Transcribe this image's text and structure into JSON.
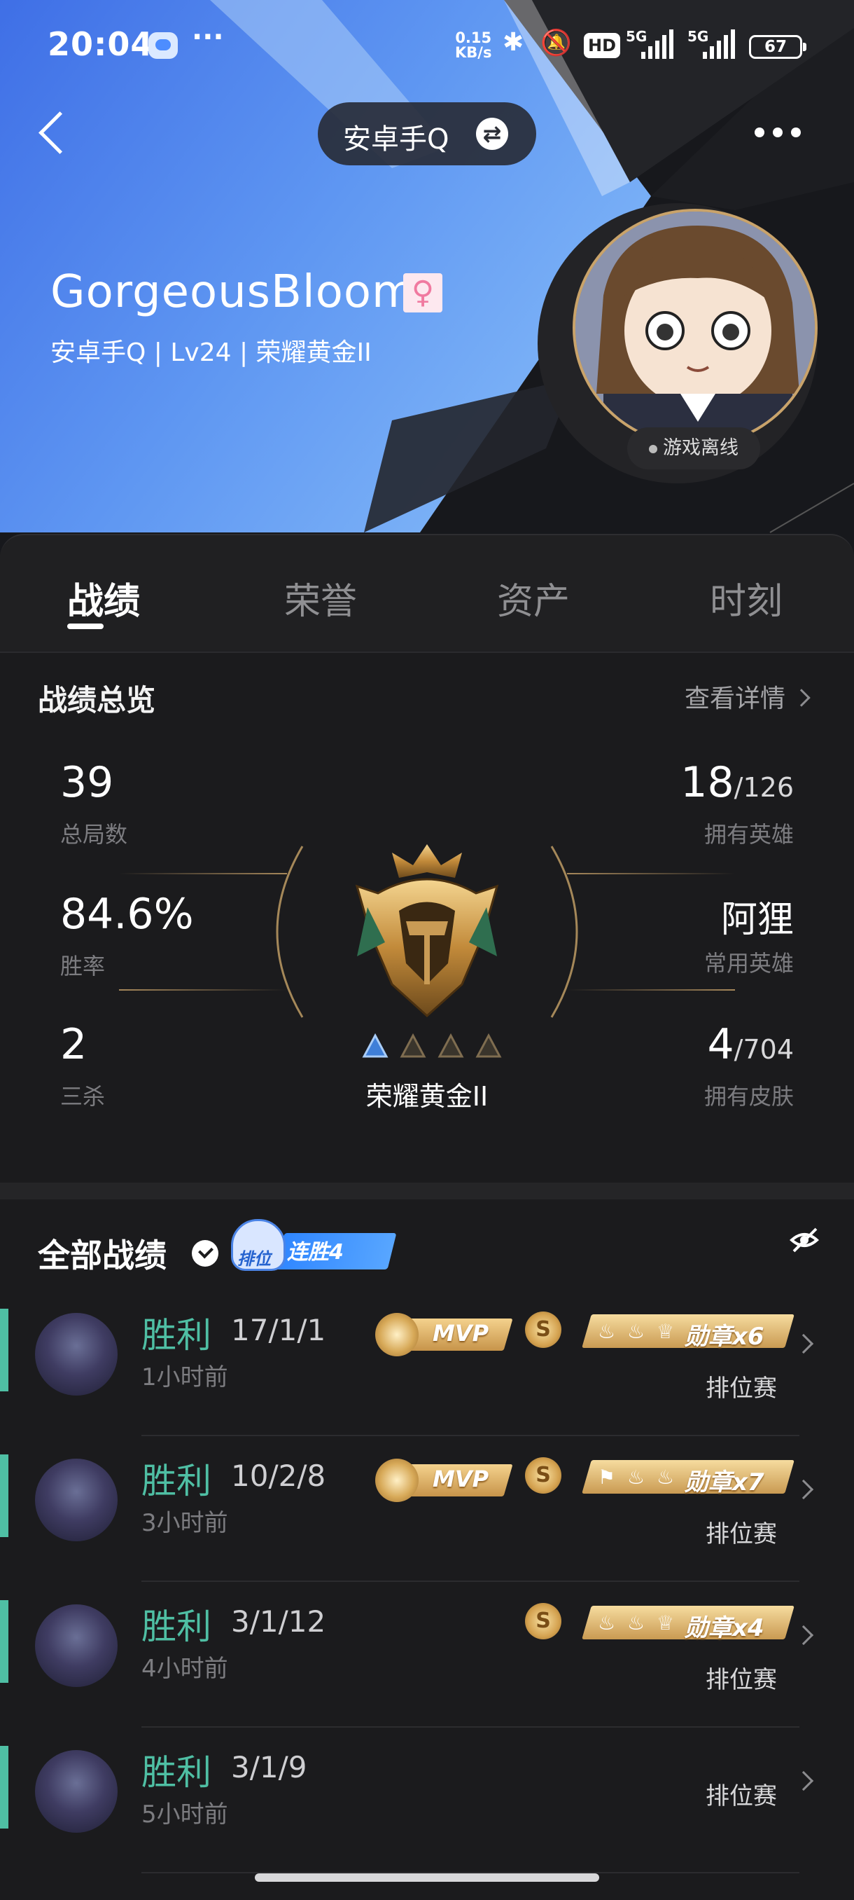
{
  "status_bar": {
    "time": "20:04",
    "net_speed_top": "0.15",
    "net_speed_bottom": "KB/s",
    "hd": "HD",
    "signal1": "5G",
    "signal2": "5G",
    "battery": "67",
    "more": "···"
  },
  "nav": {
    "account": "安卓手Q",
    "switch_icon": "swap-icon"
  },
  "profile": {
    "name": "GorgeousBloom",
    "gender_icon": "female-icon",
    "sub": "安卓手Q | Lv24 | 荣耀黄金II",
    "status": "游戏离线"
  },
  "tabs": [
    {
      "label": "战绩"
    },
    {
      "label": "荣誉"
    },
    {
      "label": "资产"
    },
    {
      "label": "时刻"
    }
  ],
  "overview": {
    "title": "战绩总览",
    "detail_link": "查看详情",
    "stats_left": [
      {
        "value": "39",
        "label": "总局数"
      },
      {
        "value": "84.6%",
        "label": "胜率"
      },
      {
        "value": "2",
        "label": "三杀"
      }
    ],
    "stats_right": [
      {
        "value": "18",
        "total": "/126",
        "label": "拥有英雄"
      },
      {
        "value": "阿狸",
        "total": "",
        "label": "常用英雄"
      },
      {
        "value": "4",
        "total": "/704",
        "label": "拥有皮肤"
      }
    ],
    "rank": "荣耀黄金II",
    "rank_stars": {
      "filled": 1,
      "total": 4
    }
  },
  "matches": {
    "title": "全部战绩",
    "streak_tag": "排位",
    "streak": "连胜4",
    "list": [
      {
        "result": "胜利",
        "kda": "17/1/1",
        "ago": "1小时前",
        "mode": "排位赛",
        "mvp": "MVP",
        "medal": "勋章x6",
        "coin": "S"
      },
      {
        "result": "胜利",
        "kda": "10/2/8",
        "ago": "3小时前",
        "mode": "排位赛",
        "mvp": "MVP",
        "medal": "勋章x7",
        "coin": "S"
      },
      {
        "result": "胜利",
        "kda": "3/1/12",
        "ago": "4小时前",
        "mode": "排位赛",
        "mvp": "",
        "medal": "勋章x4",
        "coin": "S"
      },
      {
        "result": "胜利",
        "kda": "3/1/9",
        "ago": "5小时前",
        "mode": "排位赛",
        "mvp": "",
        "medal": "",
        "coin": ""
      }
    ]
  },
  "colors": {
    "accent_win": "#4fbfa4",
    "gold": "#c9a36a",
    "hero_blue": "#4f86ea"
  }
}
